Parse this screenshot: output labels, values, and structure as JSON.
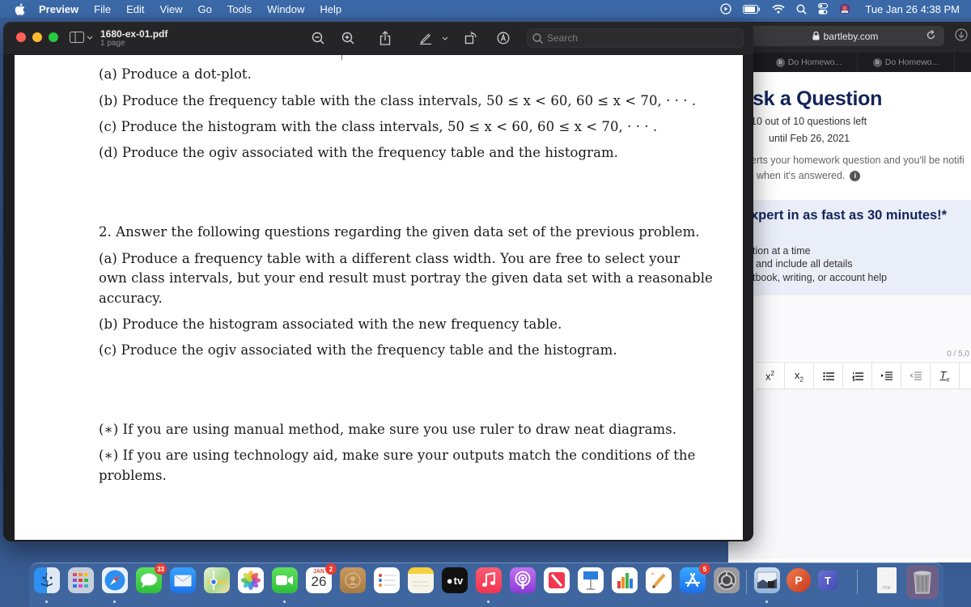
{
  "menubar": {
    "app_name": "Preview",
    "menus": [
      "File",
      "Edit",
      "View",
      "Go",
      "Tools",
      "Window",
      "Help"
    ],
    "clock": "Tue Jan 26  4:38 PM",
    "status_icons": [
      "screen-record-icon",
      "battery-icon",
      "wifi-icon",
      "spotlight-icon",
      "control-center-icon",
      "user-avatar-icon"
    ]
  },
  "preview_window": {
    "document_title": "1680-ex-01.pdf",
    "page_count": "1 page",
    "search": {
      "placeholder": "Search",
      "value": ""
    },
    "toolbar_icons": [
      "zoom-out-icon",
      "zoom-in-icon",
      "share-icon",
      "markup-pen-icon",
      "chevron-down-icon",
      "rotate-icon",
      "annotate-icon"
    ]
  },
  "document": {
    "problem1_parts": [
      "(a)  Produce a dot-plot.",
      "(b)  Produce the frequency table with the class intervals, 50 ≤ x < 60, 60 ≤ x < 70, · · · .",
      "(c)  Produce the histogram with the class intervals, 50 ≤ x < 60, 60 ≤ x < 70, · · · .",
      "(d)  Produce the ogiv associated with the frequency table and the histogram."
    ],
    "problem2_heading": "2. Answer the following questions regarding the given data set of the previous problem.",
    "problem2_a_line1": "(a)  Produce a frequency table with a different class width.  You are free to select your",
    "problem2_a_line2": "own class intervals, but your end result must portray the given data set with a reasonable",
    "problem2_a_line3": "accuracy.",
    "problem2_b": "(b)  Produce the histogram associated with the new frequency table.",
    "problem2_c": "(c)  Produce the ogiv associated with the frequency table and the histogram.",
    "note1": "(∗)  If you are using manual method, make sure you use ruler to draw neat diagrams.",
    "note2_line1": "(∗)  If you are using technology aid, make sure your outputs match the conditions of the",
    "note2_line2": "problems."
  },
  "safari": {
    "url": "bartleby.com",
    "tabs": [
      "Do Homewo...",
      "Do Homewo..."
    ],
    "ask_title": "sk a Question",
    "questions_left": "10 out of 10 questions left",
    "until_date": "until Feb 26, 2021",
    "desc_line1": "erts your homework question and you'll be notifi",
    "desc_line2": "when it's answered.",
    "expert_title": "xpert in as fast as 30 minutes!*",
    "expert_lines": [
      "tion at a time",
      "and include all details",
      "tbook, writing, or account help"
    ],
    "char_counter": "0 / 5,0",
    "editor_buttons": [
      "superscript",
      "subscript",
      "bullet-list",
      "numbered-list",
      "indent",
      "outdent",
      "clear-format"
    ]
  },
  "dock": {
    "apps": [
      {
        "name": "Finder"
      },
      {
        "name": "Launchpad"
      },
      {
        "name": "Safari"
      },
      {
        "name": "Messages",
        "badge": "33"
      },
      {
        "name": "Mail"
      },
      {
        "name": "Maps"
      },
      {
        "name": "Photos"
      },
      {
        "name": "FaceTime"
      },
      {
        "name": "Calendar",
        "badge": "2",
        "month": "JAN",
        "day": "26"
      },
      {
        "name": "Contacts"
      },
      {
        "name": "Reminders"
      },
      {
        "name": "Notes"
      },
      {
        "name": "TV",
        "label": "tv"
      },
      {
        "name": "Music"
      },
      {
        "name": "Podcasts"
      },
      {
        "name": "News"
      },
      {
        "name": "Keynote"
      },
      {
        "name": "Numbers"
      },
      {
        "name": "Pages"
      },
      {
        "name": "App Store",
        "badge": "5"
      },
      {
        "name": "System Preferences"
      },
      {
        "name": "Preview"
      },
      {
        "name": "PowerPoint",
        "label": "P"
      },
      {
        "name": "Teams",
        "label": "T"
      },
      {
        "name": "PDF Document",
        "label": "PDF"
      },
      {
        "name": "Trash"
      }
    ]
  }
}
